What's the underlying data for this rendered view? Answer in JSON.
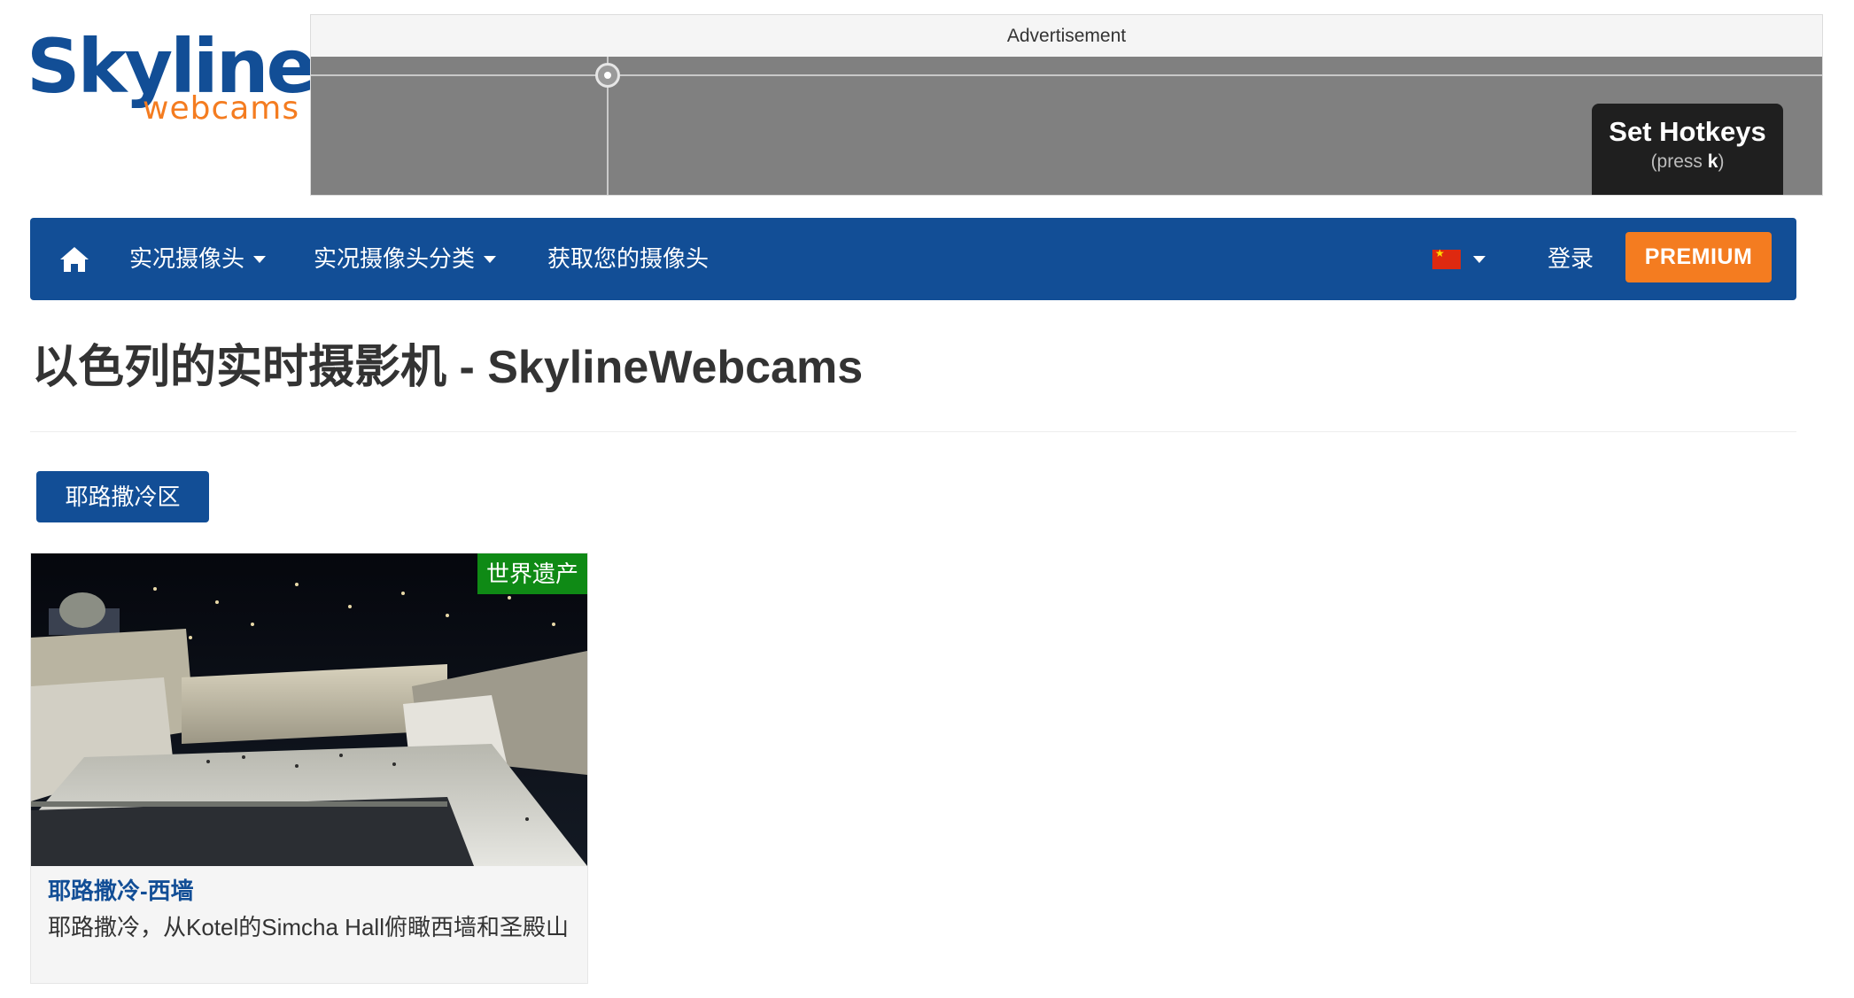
{
  "logo": {
    "main": "Skyline",
    "sub": "webcams"
  },
  "ad": {
    "label": "Advertisement",
    "hotkeys_title": "Set Hotkeys",
    "hotkeys_prefix": "(press ",
    "hotkeys_key": "k",
    "hotkeys_suffix": ")"
  },
  "nav": {
    "home_icon": "home-icon",
    "items": [
      {
        "label": "实况摄像头",
        "has_dropdown": true
      },
      {
        "label": "实况摄像头分类",
        "has_dropdown": true
      },
      {
        "label": "获取您的摄像头",
        "has_dropdown": false
      }
    ],
    "language_flag": "cn-flag-icon",
    "login": "登录",
    "premium": "PREMIUM"
  },
  "page_title": "以色列的实时摄影机 - SkylineWebcams",
  "filter_tag": "耶路撒冷区",
  "cards": [
    {
      "badge": "世界遗产",
      "title": "耶路撒冷-西墙",
      "description": "耶路撒冷，从Kotel的Simcha Hall俯瞰西墙和圣殿山"
    }
  ],
  "colors": {
    "brand_blue": "#124e96",
    "accent_orange": "#f47c20",
    "badge_green": "#0f8a15"
  }
}
